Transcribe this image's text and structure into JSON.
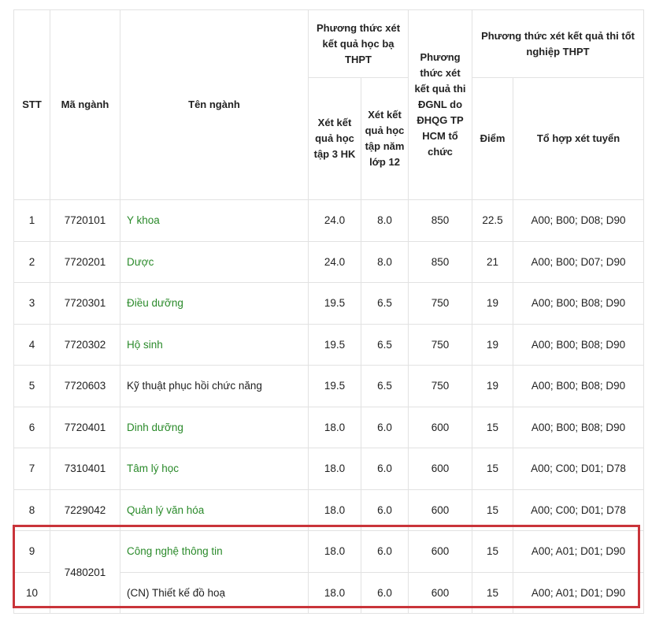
{
  "table": {
    "headers": {
      "stt": "STT",
      "code": "Mã ngành",
      "name": "Tên ngành",
      "group_hocba": "Phương thức xét kết quả học bạ THPT",
      "hk3": "Xét kết quả học tập 3 HK",
      "lop12": "Xét kết quả học tập năm lớp 12",
      "dgnl": "Phương thức xét kết quả thi ĐGNL do ĐHQG TP HCM tổ chức",
      "group_thpt": "Phương thức xét kết quả thi tốt nghiệp THPT",
      "diem": "Điểm",
      "tohop": "Tổ hợp xét tuyển"
    },
    "rows": [
      {
        "stt": "1",
        "code": "7720101",
        "name": "Y khoa",
        "link": true,
        "hk3": "24.0",
        "lop12": "8.0",
        "dgnl": "850",
        "diem": "22.5",
        "tohop": "A00; B00; D08; D90"
      },
      {
        "stt": "2",
        "code": "7720201",
        "name": "Dược",
        "link": true,
        "hk3": "24.0",
        "lop12": "8.0",
        "dgnl": "850",
        "diem": "21",
        "tohop": "A00; B00; D07; D90"
      },
      {
        "stt": "3",
        "code": "7720301",
        "name": "Điều dưỡng",
        "link": true,
        "hk3": "19.5",
        "lop12": "6.5",
        "dgnl": "750",
        "diem": "19",
        "tohop": "A00; B00; B08; D90"
      },
      {
        "stt": "4",
        "code": "7720302",
        "name": "Hộ sinh",
        "link": true,
        "hk3": "19.5",
        "lop12": "6.5",
        "dgnl": "750",
        "diem": "19",
        "tohop": "A00; B00; B08; D90"
      },
      {
        "stt": "5",
        "code": "7720603",
        "name": "Kỹ thuật phục hồi chức năng",
        "link": false,
        "hk3": "19.5",
        "lop12": "6.5",
        "dgnl": "750",
        "diem": "19",
        "tohop": "A00; B00; B08; D90"
      },
      {
        "stt": "6",
        "code": "7720401",
        "name": "Dinh dưỡng",
        "link": true,
        "hk3": "18.0",
        "lop12": "6.0",
        "dgnl": "600",
        "diem": "15",
        "tohop": "A00; B00; B08; D90"
      },
      {
        "stt": "7",
        "code": "7310401",
        "name": "Tâm lý học",
        "link": true,
        "hk3": "18.0",
        "lop12": "6.0",
        "dgnl": "600",
        "diem": "15",
        "tohop": "A00; C00; D01; D78"
      },
      {
        "stt": "8",
        "code": "7229042",
        "name": "Quản lý văn hóa",
        "link": true,
        "hk3": "18.0",
        "lop12": "6.0",
        "dgnl": "600",
        "diem": "15",
        "tohop": "A00; C00; D01; D78"
      },
      {
        "stt": "9",
        "code": "7480201",
        "name": "Công nghệ thông tin",
        "link": true,
        "hk3": "18.0",
        "lop12": "6.0",
        "dgnl": "600",
        "diem": "15",
        "tohop": "A00; A01; D01; D90"
      },
      {
        "stt": "10",
        "code": "",
        "name": "(CN) Thiết kế đồ hoạ",
        "link": false,
        "hk3": "18.0",
        "lop12": "6.0",
        "dgnl": "600",
        "diem": "15",
        "tohop": "A00; A01; D01; D90"
      }
    ]
  },
  "colors": {
    "link": "#2a8a2a",
    "highlight_border": "#c9343a",
    "grid": "#e2e2e2"
  }
}
